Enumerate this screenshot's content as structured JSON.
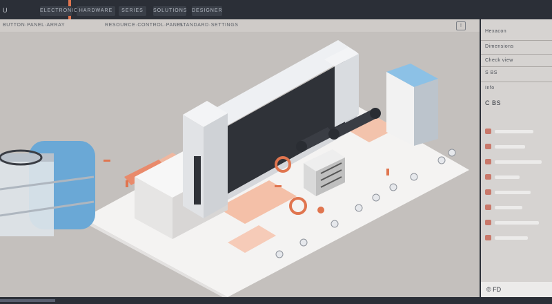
{
  "header": {
    "logo_text": "U",
    "tabs": [
      {
        "label": "ELECTRONICS"
      },
      {
        "label": "HARDWARE"
      },
      {
        "label": "SERIES"
      },
      {
        "label": "SOLUTIONS"
      },
      {
        "label": "DESIGNER"
      }
    ]
  },
  "toolbar": {
    "path_left": "BUTTON·PANEL·ARRAY",
    "path_mid": "RESOURCE·CONTROL·PANEL",
    "path_right": "STANDARD·SETTINGS",
    "icon_label": "!"
  },
  "panel": {
    "title": "Hexacon",
    "section_1": "Dimensions",
    "section_2": "Check view",
    "section_3": "S BS",
    "section_4": "Info",
    "section_5": "C BS",
    "footer_text": "© FD",
    "rows": [
      {
        "fill": 0.7
      },
      {
        "fill": 0.55
      },
      {
        "fill": 0.85
      },
      {
        "fill": 0.45
      },
      {
        "fill": 0.65
      },
      {
        "fill": 0.5
      },
      {
        "fill": 0.8
      },
      {
        "fill": 0.6
      }
    ]
  },
  "colors": {
    "accent_orange": "#e0754f",
    "panel_bg": "#d6d3d1",
    "canvas_bg": "#c4c0bd",
    "machine_blue": "#6aa8d6",
    "dark_frame": "#2b2f37"
  }
}
